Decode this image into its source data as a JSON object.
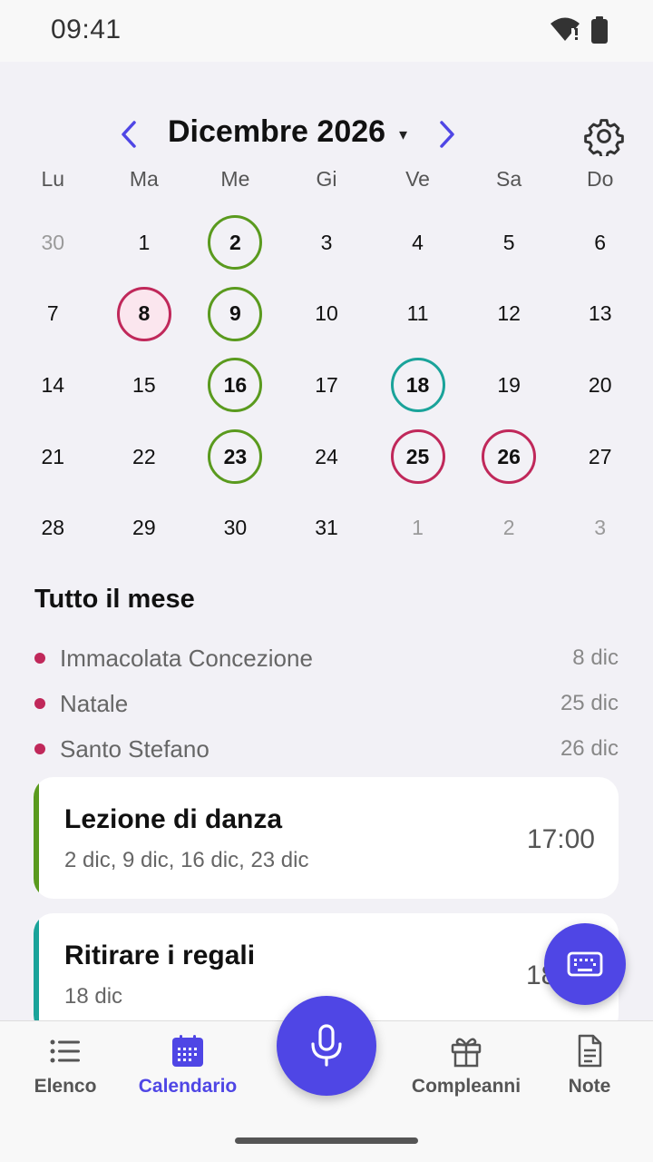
{
  "status_bar": {
    "time": "09:41"
  },
  "header": {
    "month_title": "Dicembre 2026",
    "caret": "▾"
  },
  "weekdays": [
    "Lu",
    "Ma",
    "Me",
    "Gi",
    "Ve",
    "Sa",
    "Do"
  ],
  "days": [
    {
      "label": "30",
      "muted": true
    },
    {
      "label": "1"
    },
    {
      "label": "2",
      "mark": "green"
    },
    {
      "label": "3"
    },
    {
      "label": "4"
    },
    {
      "label": "5"
    },
    {
      "label": "6"
    },
    {
      "label": "7"
    },
    {
      "label": "8",
      "mark": "red-fill"
    },
    {
      "label": "9",
      "mark": "green"
    },
    {
      "label": "10"
    },
    {
      "label": "11"
    },
    {
      "label": "12"
    },
    {
      "label": "13"
    },
    {
      "label": "14"
    },
    {
      "label": "15"
    },
    {
      "label": "16",
      "mark": "green"
    },
    {
      "label": "17"
    },
    {
      "label": "18",
      "mark": "teal"
    },
    {
      "label": "19"
    },
    {
      "label": "20"
    },
    {
      "label": "21"
    },
    {
      "label": "22"
    },
    {
      "label": "23",
      "mark": "green"
    },
    {
      "label": "24"
    },
    {
      "label": "25",
      "mark": "red"
    },
    {
      "label": "26",
      "mark": "red"
    },
    {
      "label": "27"
    },
    {
      "label": "28"
    },
    {
      "label": "29"
    },
    {
      "label": "30"
    },
    {
      "label": "31"
    },
    {
      "label": "1",
      "muted": true
    },
    {
      "label": "2",
      "muted": true
    },
    {
      "label": "3",
      "muted": true
    }
  ],
  "month_section": {
    "title": "Tutto il mese",
    "holidays": [
      {
        "name": "Immacolata Concezione",
        "date": "8 dic"
      },
      {
        "name": "Natale",
        "date": "25 dic"
      },
      {
        "name": "Santo Stefano",
        "date": "26 dic"
      }
    ]
  },
  "events": [
    {
      "title": "Lezione di danza",
      "dates": "2 dic, 9 dic, 16 dic, 23 dic",
      "time": "17:00",
      "color": "#5a9a1e"
    },
    {
      "title": "Ritirare i regali",
      "dates": "18 dic",
      "time": "18",
      "color": "#1aa39a"
    }
  ],
  "bottom_nav": {
    "list": "Elenco",
    "calendar": "Calendario",
    "birthdays": "Compleanni",
    "notes": "Note"
  },
  "colors": {
    "accent": "#4f46e5",
    "green": "#5a9a1e",
    "red": "#c0285a",
    "teal": "#1aa39a"
  }
}
